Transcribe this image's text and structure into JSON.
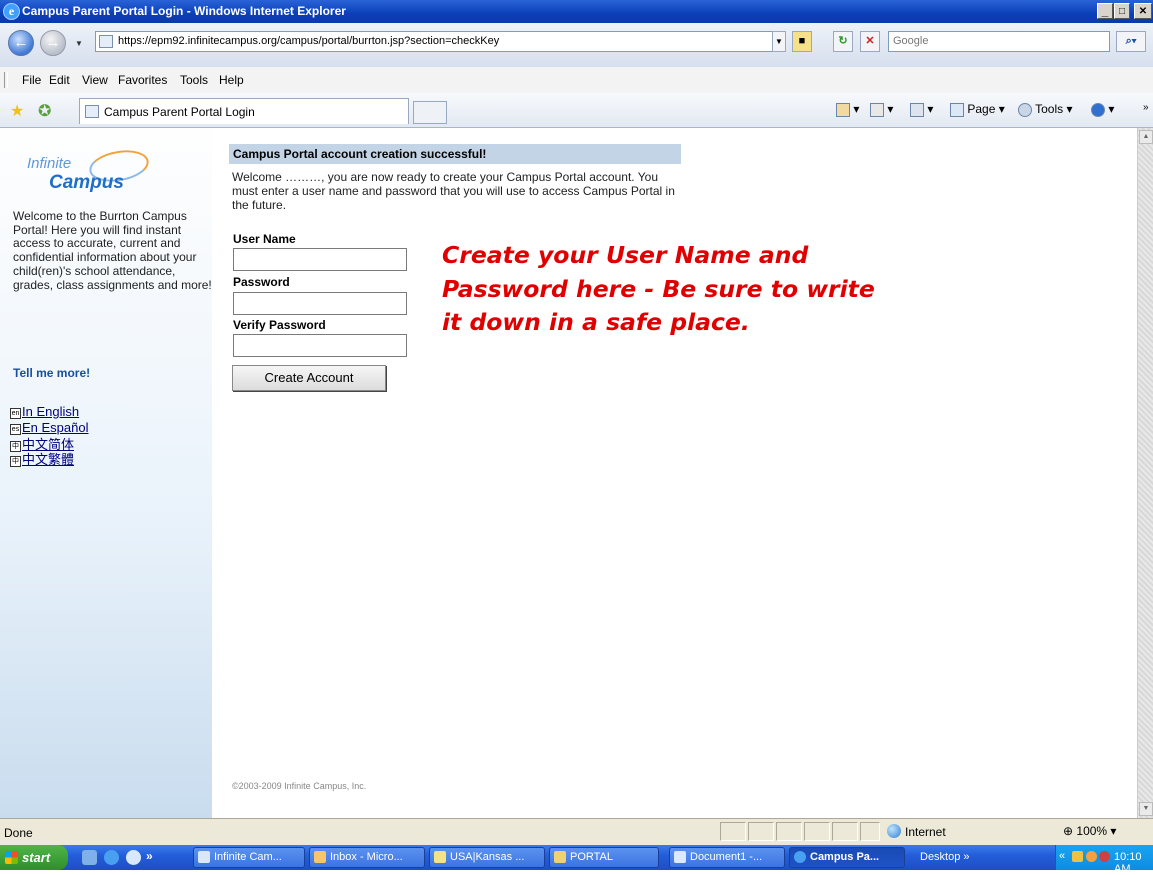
{
  "window": {
    "title": "Campus Parent Portal Login - Windows Internet Explorer",
    "min_glyph": "_",
    "max_glyph": "□",
    "close_glyph": "✕"
  },
  "address_bar": {
    "url": "https://epm92.infinitecampus.org/campus/portal/burrton.jsp?section=checkKey",
    "search_placeholder": "Google"
  },
  "menu": [
    "File",
    "Edit",
    "View",
    "Favorites",
    "Tools",
    "Help"
  ],
  "tab": {
    "label": "Campus Parent Portal Login"
  },
  "command_bar": {
    "page_label": "Page",
    "tools_label": "Tools"
  },
  "sidebar": {
    "logo_line1": "Infinite",
    "logo_line2": "Campus",
    "welcome_text": "Welcome to the Burrton Campus Portal! Here you will find instant access to accurate, current and confidential information about your child(ren)'s school attendance, grades, class assignments and more!",
    "tell_more": "Tell me more!",
    "languages": [
      {
        "badge": "en",
        "label": "In English"
      },
      {
        "badge": "es",
        "label": "En Español"
      },
      {
        "badge": "中",
        "label": "中文简体"
      },
      {
        "badge": "中",
        "label": "中文繁體"
      }
    ]
  },
  "main": {
    "header": "Campus Portal account creation successful!",
    "welcome": "Welcome ………, you are now ready to create your Campus Portal account. You must enter a user name and password that you will use to access Campus Portal in the future.",
    "username_label": "User Name",
    "password_label": "Password",
    "verify_label": "Verify Password",
    "create_button": "Create Account",
    "annotation": "Create your User Name and Password here - Be sure to write it down in a safe place.",
    "copyright": "©2003-2009 Infinite Campus, Inc."
  },
  "status_bar": {
    "status": "Done",
    "zone": "Internet",
    "zoom": "100%"
  },
  "taskbar": {
    "start": "start",
    "tasks": [
      {
        "label": "Infinite Cam...",
        "active": false
      },
      {
        "label": "Inbox - Micro...",
        "active": false
      },
      {
        "label": "USA|Kansas ...",
        "active": false
      },
      {
        "label": "PORTAL",
        "active": false
      },
      {
        "label": "Document1 -...",
        "active": false
      },
      {
        "label": "Campus Pa...",
        "active": true
      }
    ],
    "desktop": "Desktop",
    "clock": "10:10 AM"
  },
  "colors": {
    "accent_header": "#c3d4e6",
    "annotation_red": "#e10000",
    "link_blue": "#1a4fa0"
  }
}
